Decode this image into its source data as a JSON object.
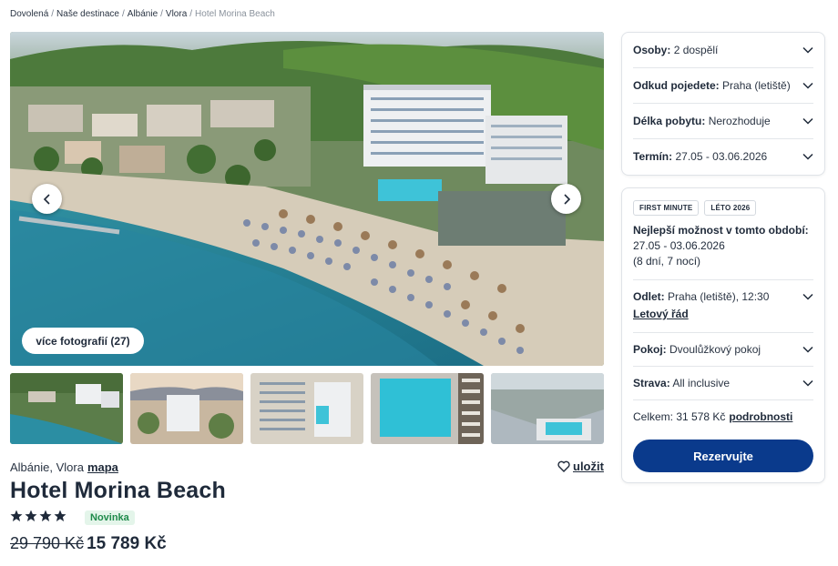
{
  "breadcrumb": {
    "items": [
      "Dovolená",
      "Naše destinace",
      "Albánie",
      "Vlora"
    ],
    "current": "Hotel Morina Beach",
    "separator": "/"
  },
  "gallery": {
    "more_photos": "více fotografií (27)",
    "thumbnail_count": 5
  },
  "hotel": {
    "location": "Albánie, Vlora",
    "map_link": "mapa",
    "save": "uložit",
    "name": "Hotel Morina Beach",
    "stars": 4,
    "badge": "Novinka",
    "price_old": "29 790 Kč",
    "price_new": "15 789 Kč"
  },
  "filters": {
    "persons": {
      "label": "Osoby:",
      "value": "2 dospělí"
    },
    "departure": {
      "label": "Odkud pojedete:",
      "value": "Praha (letiště)"
    },
    "length": {
      "label": "Délka pobytu:",
      "value": "Nerozhoduje"
    },
    "term": {
      "label": "Termín:",
      "value": "27.05 - 03.06.2026"
    }
  },
  "booking": {
    "tags": [
      "FIRST MINUTE",
      "LÉTO 2026"
    ],
    "best_option_heading": "Nejlepší možnost v tomto období:",
    "dates": "27.05 - 03.06.2026",
    "nights": "(8 dní, 7 nocí)",
    "flight": {
      "label": "Odlet:",
      "value": "Praha (letiště), 12:30",
      "link": "Letový řád"
    },
    "room": {
      "label": "Pokoj:",
      "value": "Dvoulůžkový pokoj"
    },
    "board": {
      "label": "Strava:",
      "value": "All inclusive"
    },
    "total_label": "Celkem: 31 578 Kč",
    "details_link": "podrobnosti",
    "reserve_button": "Rezervujte"
  },
  "colors": {
    "primary": "#0a3a8c",
    "badge_green": "#1e8a4a",
    "badge_bg": "#e4f5ea",
    "text": "#1f2a3a"
  }
}
